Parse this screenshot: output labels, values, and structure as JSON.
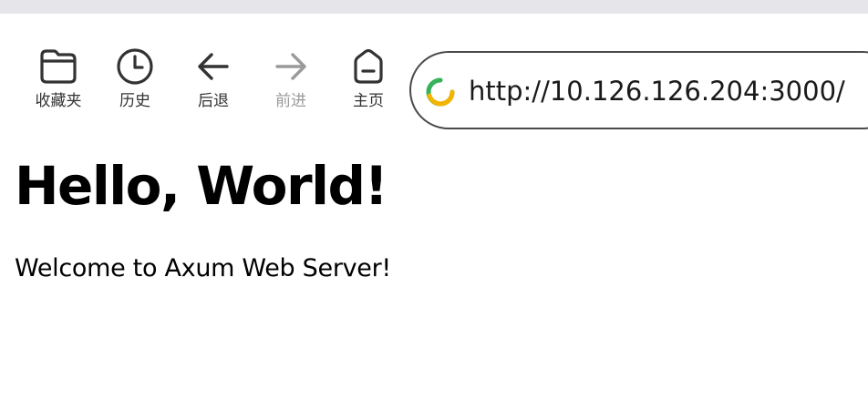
{
  "toolbar": {
    "bookmarks_label": "收藏夹",
    "history_label": "历史",
    "back_label": "后退",
    "forward_label": "前进",
    "home_label": "主页"
  },
  "address_bar": {
    "url": "http://10.126.126.204:3000/"
  },
  "page": {
    "heading": "Hello, World!",
    "text": "Welcome to Axum Web Server!"
  },
  "colors": {
    "site_icon_green": "#34b35a",
    "site_icon_yellow": "#f4b400",
    "icon_stroke": "#333333",
    "disabled_stroke": "#9a9a9a"
  }
}
